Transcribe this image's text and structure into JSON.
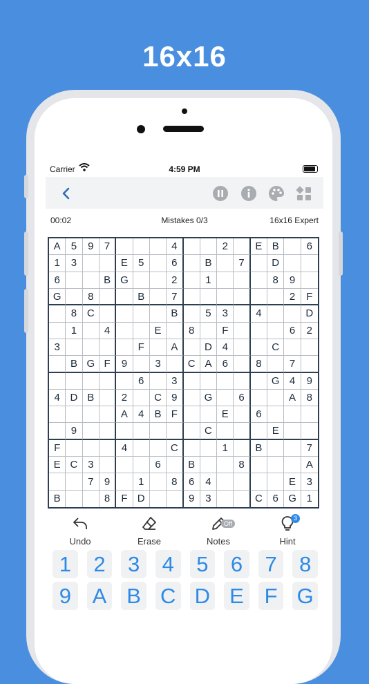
{
  "headline": "16x16",
  "status": {
    "carrier": "Carrier",
    "time": "4:59 PM"
  },
  "nav": {
    "back_icon": "chevron-left-icon",
    "pause_icon": "pause-icon",
    "info_icon": "info-icon",
    "theme_icon": "palette-icon",
    "layout_icon": "grid-shapes-icon",
    "accent": "#a9acb1"
  },
  "info": {
    "timer": "00:02",
    "mistakes": "Mistakes 0/3",
    "level": "16x16 Expert"
  },
  "board": {
    "rows": [
      [
        "A",
        "5",
        "9",
        "7",
        "",
        "",
        "",
        "4",
        "",
        "",
        "2",
        "",
        "E",
        "B",
        "",
        "6"
      ],
      [
        "1",
        "3",
        "",
        "",
        "E",
        "5",
        "",
        "6",
        "",
        "B",
        "",
        "7",
        "",
        "D",
        "",
        ""
      ],
      [
        "6",
        "",
        "",
        "B",
        "G",
        "",
        "",
        "2",
        "",
        "1",
        "",
        "",
        "",
        "8",
        "9",
        ""
      ],
      [
        "G",
        "",
        "8",
        "",
        "",
        "B",
        "",
        "7",
        "",
        "",
        "",
        "",
        "",
        "",
        "2",
        "F"
      ],
      [
        "",
        "8",
        "C",
        "",
        "",
        "",
        "",
        "B",
        "",
        "5",
        "3",
        "",
        "4",
        "",
        "",
        "D"
      ],
      [
        "",
        "1",
        "",
        "4",
        "",
        "",
        "E",
        "",
        "8",
        "",
        "F",
        "",
        "",
        "",
        "6",
        "2"
      ],
      [
        "3",
        "",
        "",
        "",
        "",
        "F",
        "",
        "A",
        "",
        "D",
        "4",
        "",
        "",
        "C",
        "",
        ""
      ],
      [
        "",
        "B",
        "G",
        "F",
        "9",
        "",
        "3",
        "",
        "C",
        "A",
        "6",
        "",
        "8",
        "",
        "7",
        ""
      ],
      [
        "",
        "",
        "",
        "",
        "",
        "6",
        "",
        "3",
        "",
        "",
        "",
        "",
        "",
        "G",
        "4",
        "9"
      ],
      [
        "4",
        "D",
        "B",
        "",
        "2",
        "",
        "C",
        "9",
        "",
        "G",
        "",
        "6",
        "",
        "",
        "A",
        "8"
      ],
      [
        "",
        "",
        "",
        "",
        "A",
        "4",
        "B",
        "F",
        "",
        "",
        "E",
        "",
        "6",
        "",
        "",
        ""
      ],
      [
        "",
        "9",
        "",
        "",
        "",
        "",
        "",
        "",
        "",
        "C",
        "",
        "",
        "",
        "E",
        "",
        ""
      ],
      [
        "F",
        "",
        "",
        "",
        "4",
        "",
        "",
        "C",
        "",
        "",
        "1",
        "",
        "B",
        "",
        "",
        "7"
      ],
      [
        "E",
        "C",
        "3",
        "",
        "",
        "",
        "6",
        "",
        "B",
        "",
        "",
        "8",
        "",
        "",
        "",
        "A"
      ],
      [
        "",
        "",
        "7",
        "9",
        "",
        "1",
        "",
        "8",
        "6",
        "4",
        "",
        "",
        "",
        "",
        "E",
        "3"
      ],
      [
        "B",
        "",
        "",
        "8",
        "F",
        "D",
        "",
        "",
        "9",
        "3",
        "",
        "",
        "C",
        "6",
        "G",
        "1"
      ]
    ]
  },
  "tools": {
    "undo": "Undo",
    "erase": "Erase",
    "notes": "Notes",
    "notes_state": "Off",
    "hint": "Hint",
    "hint_count": "3"
  },
  "keypad": [
    "1",
    "2",
    "3",
    "4",
    "5",
    "6",
    "7",
    "8",
    "9",
    "A",
    "B",
    "C",
    "D",
    "E",
    "F",
    "G"
  ],
  "colors": {
    "background": "#4a8fdf",
    "accent": "#2d8ae6",
    "grid": "#2c3e50"
  }
}
